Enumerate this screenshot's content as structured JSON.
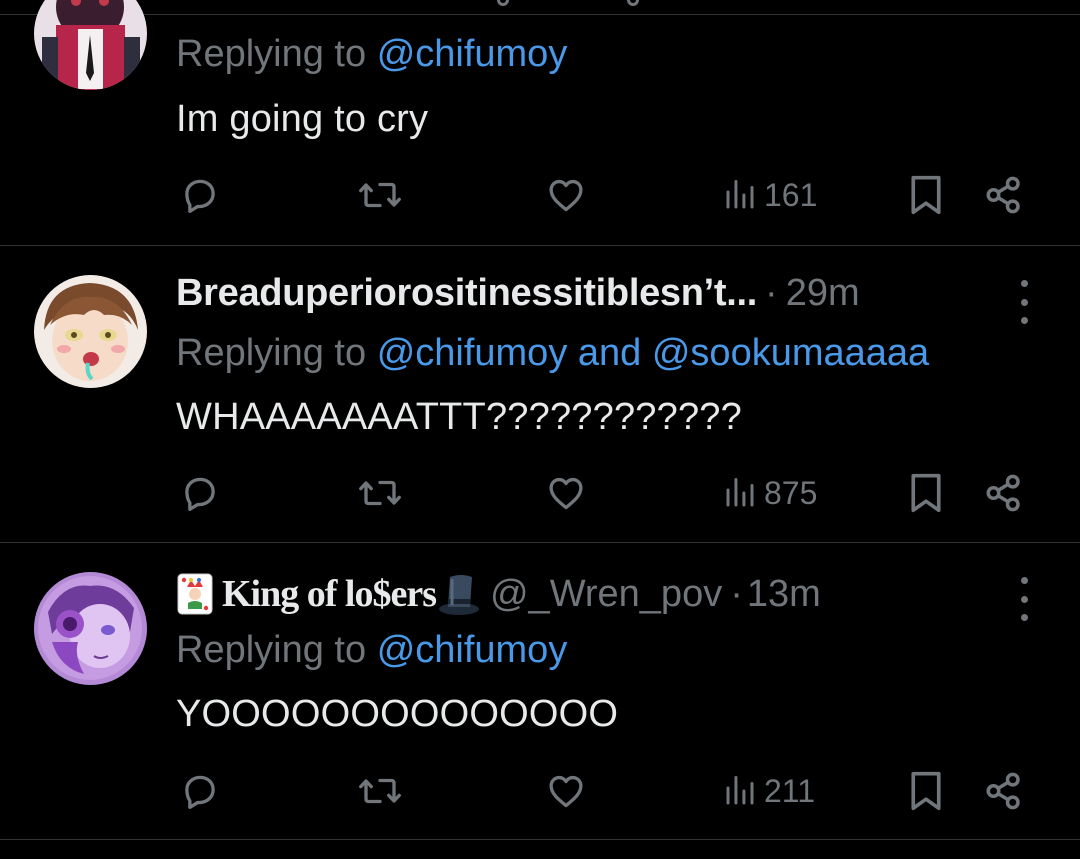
{
  "tweets": [
    {
      "reply_prefix": "Replying to",
      "reply_to": "@chifumoy",
      "text": "Im going to cry",
      "views": "161"
    },
    {
      "name": "Breaduperiorositinessitiblesn’t...",
      "separator": "·",
      "time": "29m",
      "reply_prefix": "Replying to",
      "reply_to": "@chifumoy and @sookumaaaaa",
      "text": "WHAAAAAAATTT????????????",
      "views": "875"
    },
    {
      "name": "King of lo$ers",
      "handle": "@_Wren_pov",
      "separator": "·",
      "time": "13m",
      "reply_prefix": "Replying to",
      "reply_to": "@chifumoy",
      "text": "YOOOOOOOOOOOOOO",
      "views": "211"
    }
  ],
  "colors": {
    "background": "#000000",
    "text": "#e7e9ea",
    "muted": "#71767b",
    "link": "#4a99e9",
    "divider": "#2f3336"
  },
  "icons": {
    "reply": "reply-icon",
    "retweet": "retweet-icon",
    "like": "heart-icon",
    "views": "views-chart-icon",
    "bookmark": "bookmark-icon",
    "share": "share-icon",
    "more": "more-vertical-icon",
    "name_emoji_1": "joker-card-emoji",
    "name_emoji_2": "top-hat-emoji"
  }
}
